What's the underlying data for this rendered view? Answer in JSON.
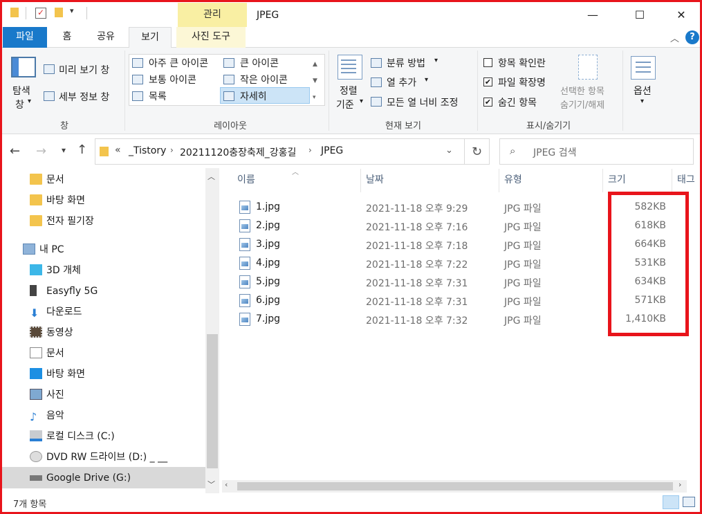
{
  "window": {
    "title": "JPEG",
    "contextual_tab": "관리",
    "minimize": "—",
    "maximize": "☐",
    "close": "✕"
  },
  "tabs": {
    "file": "파일",
    "home": "홈",
    "share": "공유",
    "view": "보기",
    "picture_tools": "사진 도구"
  },
  "ribbon": {
    "panes": {
      "nav_pane_line1": "탐색",
      "nav_pane_line2": "창",
      "preview": "미리 보기 창",
      "details": "세부 정보 창",
      "group": "창"
    },
    "layout": {
      "extra_large": "아주 큰 아이콘",
      "large": "큰 아이콘",
      "medium": "보통 아이콘",
      "small": "작은 아이콘",
      "list": "목록",
      "details": "자세히",
      "group": "레이아웃"
    },
    "current_view": {
      "sort_line1": "정렬",
      "sort_line2": "기준",
      "group_by": "분류 방법",
      "add_columns": "열 추가",
      "fit_columns": "모든 열 너비 조정",
      "group": "현재 보기"
    },
    "show_hide": {
      "item_checkboxes": "항목 확인란",
      "file_extensions": "파일 확장명",
      "hidden_items": "숨긴 항목",
      "hide_selected_line1": "선택한 항목",
      "hide_selected_line2": "숨기기/해제",
      "group": "표시/숨기기",
      "item_checkboxes_checked": false,
      "file_extensions_checked": true,
      "hidden_items_checked": true
    },
    "options": "옵션"
  },
  "address": {
    "prefix": "«",
    "crumbs": [
      "_Tistory",
      "20211120충장축제_강홍길",
      "JPEG"
    ],
    "search_placeholder": "JPEG 검색"
  },
  "nav": {
    "items": [
      {
        "label": "문서",
        "icon": "folder-icon"
      },
      {
        "label": "바탕 화면",
        "icon": "folder-icon"
      },
      {
        "label": "전자 필기장",
        "icon": "folder-icon"
      },
      {
        "label": "내 PC",
        "icon": "pc-icon"
      },
      {
        "label": "3D 개체",
        "icon": "cube-icon"
      },
      {
        "label": "Easyfly 5G",
        "icon": "phone-icon"
      },
      {
        "label": "다운로드",
        "icon": "download-icon"
      },
      {
        "label": "동영상",
        "icon": "video-icon"
      },
      {
        "label": "문서",
        "icon": "document-icon"
      },
      {
        "label": "바탕 화면",
        "icon": "desktop-icon"
      },
      {
        "label": "사진",
        "icon": "picture-icon"
      },
      {
        "label": "음악",
        "icon": "music-icon"
      },
      {
        "label": "로컬 디스크 (C:)",
        "icon": "disk-icon"
      },
      {
        "label": "DVD RW 드라이브 (D:) _ __",
        "icon": "dvd-icon"
      },
      {
        "label": "Google Drive (G:)",
        "icon": "drive-icon"
      }
    ]
  },
  "columns": {
    "name": "이름",
    "date": "날짜",
    "type": "유형",
    "size": "크기",
    "tags": "태그"
  },
  "files": [
    {
      "name": "1.jpg",
      "date": "2021-11-18 오후 9:29",
      "type": "JPG 파일",
      "size": "582KB"
    },
    {
      "name": "2.jpg",
      "date": "2021-11-18 오후 7:16",
      "type": "JPG 파일",
      "size": "618KB"
    },
    {
      "name": "3.jpg",
      "date": "2021-11-18 오후 7:18",
      "type": "JPG 파일",
      "size": "664KB"
    },
    {
      "name": "4.jpg",
      "date": "2021-11-18 오후 7:22",
      "type": "JPG 파일",
      "size": "531KB"
    },
    {
      "name": "5.jpg",
      "date": "2021-11-18 오후 7:31",
      "type": "JPG 파일",
      "size": "634KB"
    },
    {
      "name": "6.jpg",
      "date": "2021-11-18 오후 7:31",
      "type": "JPG 파일",
      "size": "571KB"
    },
    {
      "name": "7.jpg",
      "date": "2021-11-18 오후 7:32",
      "type": "JPG 파일",
      "size": "1,410KB"
    }
  ],
  "status": {
    "count": "7개 항목"
  },
  "colors": {
    "file_tab": "#1979ca",
    "contextual_tab": "#f9efa3",
    "highlight_box": "#e8141b",
    "selection": "#cce4f7"
  }
}
